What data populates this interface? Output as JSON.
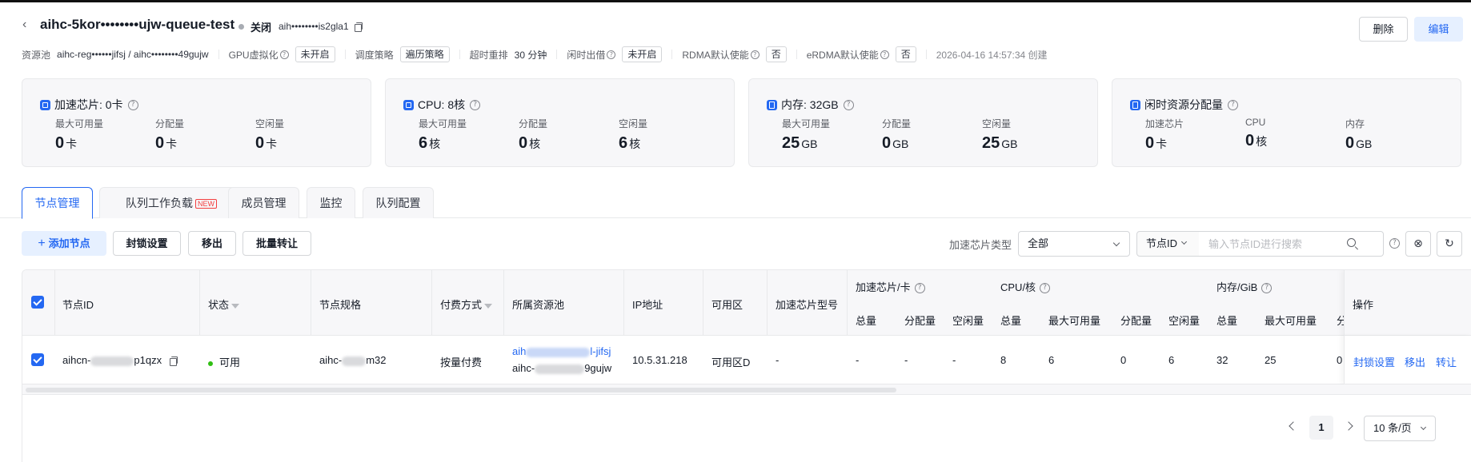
{
  "header": {
    "title": "aihc-5kor••••••••ujw-queue-test",
    "status": "关闭",
    "sub_id": "aih••••••••is2gla1",
    "delete_label": "删除",
    "edit_label": "编辑"
  },
  "meta": {
    "pool_label": "资源池",
    "pool_value": "aihc-reg••••••jifsj / aihc••••••••49gujw",
    "gpu_virt_label": "GPU虚拟化",
    "gpu_virt_value": "未开启",
    "sched_label": "调度策略",
    "sched_value": "遍历策略",
    "timeout_label": "超时重排",
    "timeout_value": "30 分钟",
    "idle_label": "闲时出借",
    "idle_value": "未开启",
    "rdma_label": "RDMA默认使能",
    "rdma_value": "否",
    "erdma_label": "eRDMA默认使能",
    "erdma_value": "否",
    "created": "2026-04-16 14:57:34 创建"
  },
  "cards": [
    {
      "title": "加速芯片: 0卡",
      "icon": "chip-icon",
      "metrics": [
        {
          "label": "最大可用量",
          "value": "0",
          "unit": "卡"
        },
        {
          "label": "分配量",
          "value": "0",
          "unit": "卡"
        },
        {
          "label": "空闲量",
          "value": "0",
          "unit": "卡"
        }
      ]
    },
    {
      "title": "CPU: 8核",
      "icon": "cpu-icon",
      "metrics": [
        {
          "label": "最大可用量",
          "value": "6",
          "unit": "核"
        },
        {
          "label": "分配量",
          "value": "0",
          "unit": "核"
        },
        {
          "label": "空闲量",
          "value": "6",
          "unit": "核"
        }
      ]
    },
    {
      "title": "内存: 32GB",
      "icon": "memory-icon",
      "metrics": [
        {
          "label": "最大可用量",
          "value": "25",
          "unit": "GB"
        },
        {
          "label": "分配量",
          "value": "0",
          "unit": "GB"
        },
        {
          "label": "空闲量",
          "value": "25",
          "unit": "GB"
        }
      ]
    },
    {
      "title": "闲时资源分配量",
      "icon": "idle-resource-icon",
      "metrics": [
        {
          "label": "加速芯片",
          "value": "0",
          "unit": "卡"
        },
        {
          "label": "CPU",
          "value": "0",
          "unit": "核"
        },
        {
          "label": "内存",
          "value": "0",
          "unit": "GB"
        }
      ]
    }
  ],
  "tabs": [
    {
      "label": "节点管理"
    },
    {
      "label": "队列工作负载",
      "badge": "NEW"
    },
    {
      "label": "成员管理"
    },
    {
      "label": "监控"
    },
    {
      "label": "队列配置"
    }
  ],
  "toolbar": {
    "add_node": "添加节点",
    "lock_settings": "封锁设置",
    "move_out": "移出",
    "batch_transfer": "批量转让",
    "chip_type_label": "加速芯片类型",
    "chip_type_value": "全部",
    "search_field": "节点ID",
    "search_placeholder": "输入节点ID进行搜索"
  },
  "table": {
    "headers": {
      "node_id": "节点ID",
      "status": "状态",
      "spec": "节点规格",
      "payment": "付费方式",
      "pool": "所属资源池",
      "ip": "IP地址",
      "zone": "可用区",
      "chip_model": "加速芯片型号",
      "chip_group": "加速芯片/卡",
      "cpu_group": "CPU/核",
      "mem_group": "内存/GiB",
      "total": "总量",
      "allocated": "分配量",
      "free": "空闲量",
      "max_avail": "最大可用量",
      "mem_alloc_partial": "分",
      "ops": "操作"
    },
    "row": {
      "node_id_prefix": "aihcn-",
      "node_id_suffix": "p1qzx",
      "status": "可用",
      "spec_prefix": "aihc-",
      "spec_suffix": "m32",
      "payment": "按量付费",
      "pool_link_prefix": "aih",
      "pool_link_suffix": "l-jifsj",
      "pool_sub_prefix": "aihc-",
      "pool_sub_suffix": "9gujw",
      "ip": "10.5.31.218",
      "zone": "可用区D",
      "chip_model": "-",
      "chip_total": "-",
      "chip_alloc": "-",
      "chip_free": "-",
      "cpu_total": "8",
      "cpu_max": "6",
      "cpu_alloc": "0",
      "cpu_free": "6",
      "mem_total": "32",
      "mem_max": "25",
      "mem_alloc_partial": "0",
      "op_lock": "封锁设置",
      "op_move": "移出",
      "op_transfer": "转让"
    }
  },
  "pagination": {
    "current": "1",
    "page_size": "10 条/页"
  },
  "colors": {
    "primary": "#2468f2",
    "success": "#30bf13",
    "danger": "#f33e3e"
  }
}
